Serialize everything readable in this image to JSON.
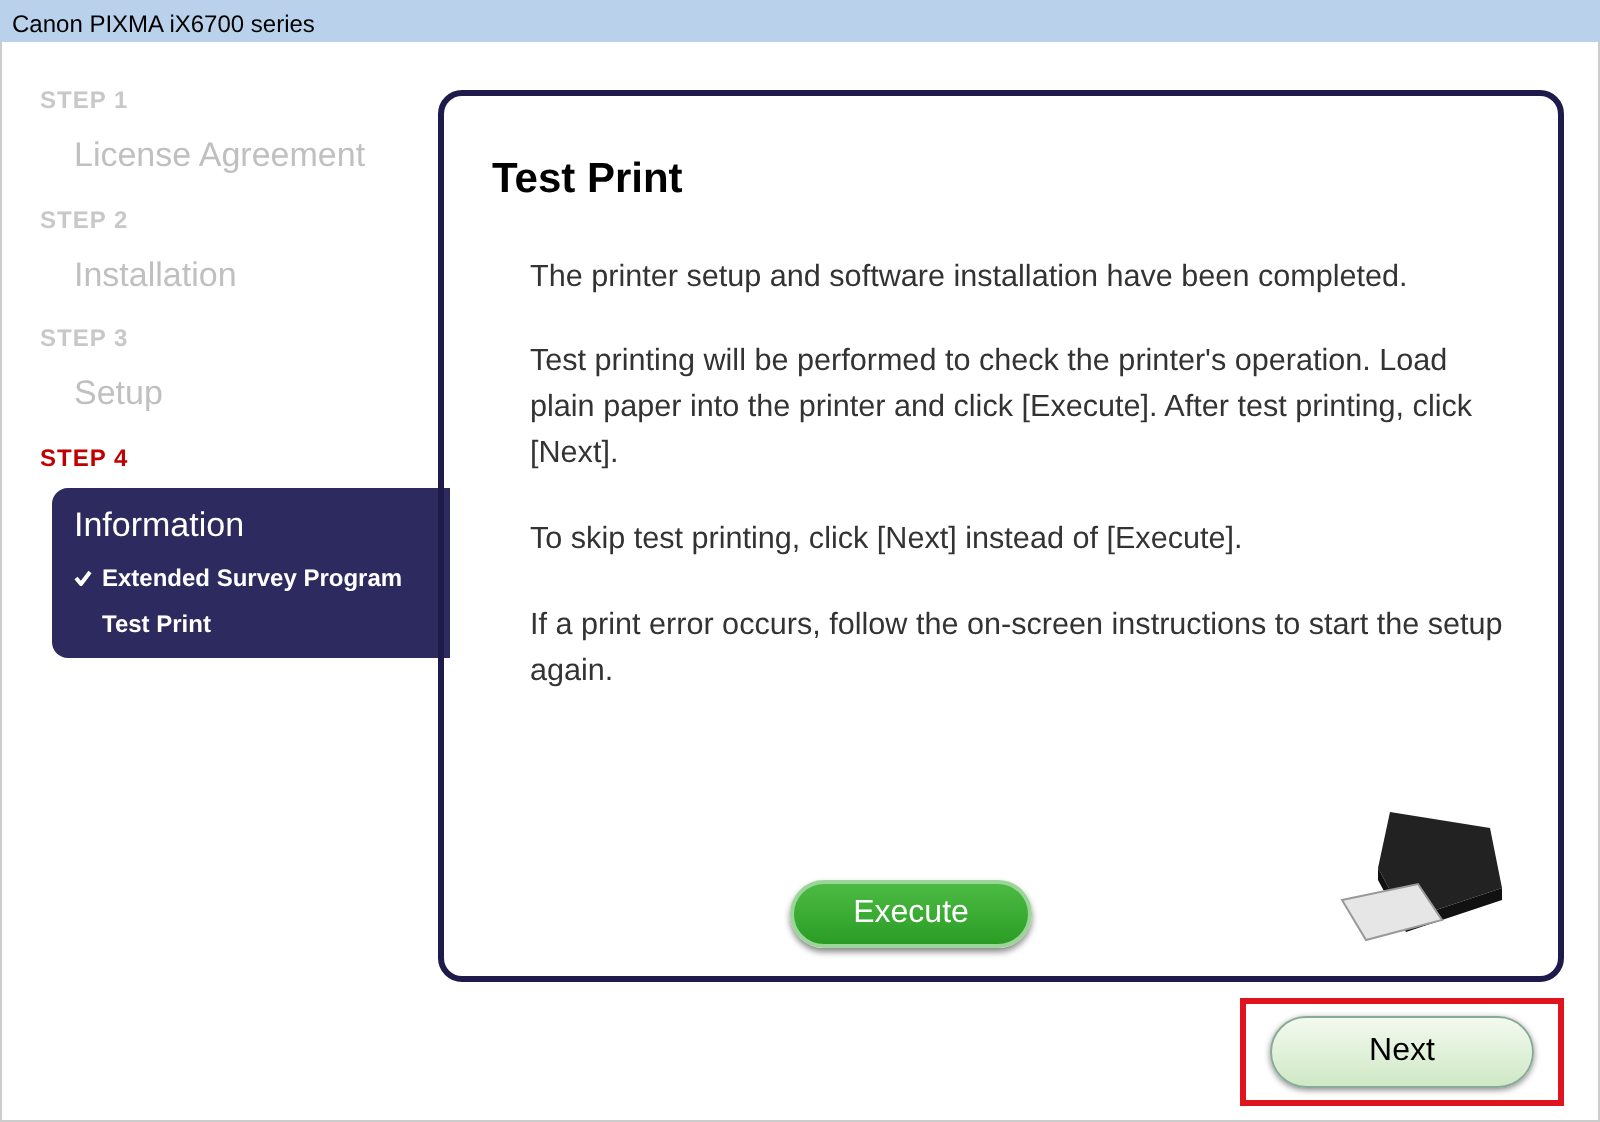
{
  "window": {
    "title": "Canon PIXMA iX6700 series"
  },
  "steps": [
    {
      "label": "STEP 1",
      "title": "License Agreement",
      "selected": false
    },
    {
      "label": "STEP 2",
      "title": "Installation",
      "selected": false
    },
    {
      "label": "STEP 3",
      "title": "Setup",
      "selected": false
    },
    {
      "label": "STEP 4",
      "title": "Information",
      "selected": true,
      "items": [
        {
          "label": "Extended Survey Program",
          "checked": true
        },
        {
          "label": "Test Print",
          "checked": false
        }
      ]
    }
  ],
  "panel": {
    "heading": "Test Print",
    "paragraphs": [
      "The printer setup and software installation have been completed.",
      "Test printing will be performed to check the printer's operation. Load plain paper into the printer and click [Execute]. After test printing, click [Next].",
      "To skip test printing, click [Next] instead of [Execute].",
      "If a print error occurs, follow the on-screen instructions to start the setup again."
    ],
    "button": "Execute"
  },
  "next_button": {
    "label": "Next",
    "highlighted": true
  }
}
